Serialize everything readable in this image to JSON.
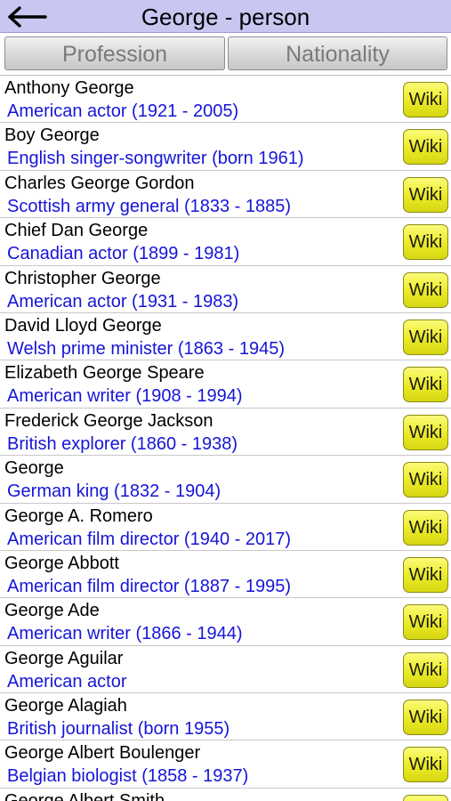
{
  "header": {
    "title": "George - person",
    "back_icon": "back-arrow-icon"
  },
  "tabs": [
    {
      "label": "Profession"
    },
    {
      "label": "Nationality"
    }
  ],
  "wiki_label": "Wiki",
  "colors": {
    "header_bg": "#c9c6f2",
    "description_text": "#1515d8",
    "wiki_button": "#ecec2a"
  },
  "people": [
    {
      "name": "Anthony George",
      "description": "American actor (1921 - 2005)"
    },
    {
      "name": "Boy George",
      "description": "English singer-songwriter (born 1961)"
    },
    {
      "name": "Charles George Gordon",
      "description": "Scottish army general (1833 - 1885)"
    },
    {
      "name": "Chief Dan George",
      "description": "Canadian actor (1899 - 1981)"
    },
    {
      "name": "Christopher George",
      "description": "American actor (1931 - 1983)"
    },
    {
      "name": "David Lloyd George",
      "description": "Welsh prime minister (1863 - 1945)"
    },
    {
      "name": "Elizabeth George Speare",
      "description": "American writer (1908 - 1994)"
    },
    {
      "name": "Frederick George Jackson",
      "description": "British explorer (1860 - 1938)"
    },
    {
      "name": "George",
      "description": "German king (1832 - 1904)"
    },
    {
      "name": "George A. Romero",
      "description": "American film director (1940 - 2017)"
    },
    {
      "name": "George Abbott",
      "description": "American film director (1887 - 1995)"
    },
    {
      "name": "George Ade",
      "description": "American writer (1866 - 1944)"
    },
    {
      "name": "George Aguilar",
      "description": "American actor"
    },
    {
      "name": "George Alagiah",
      "description": "British journalist (born 1955)"
    },
    {
      "name": "George Albert Boulenger",
      "description": "Belgian biologist (1858 - 1937)"
    },
    {
      "name": "George Albert Smith",
      "description": ""
    }
  ]
}
